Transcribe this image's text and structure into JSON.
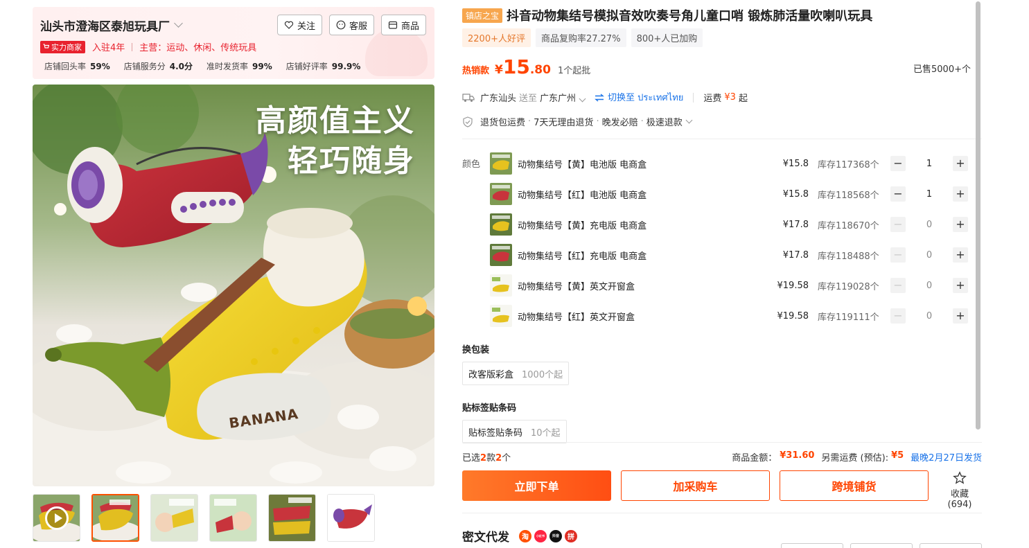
{
  "shop": {
    "name": "汕头市澄海区泰旭玩具厂",
    "follow_label": "关注",
    "service_label": "客服",
    "goods_label": "商品",
    "badge": "实力商家",
    "years": "入驻4年",
    "main_category": "主营：运动、休闲、传统玩具",
    "stats": [
      {
        "label": "店铺回头率",
        "value": "59%"
      },
      {
        "label": "店铺服务分",
        "value": "4.0分"
      },
      {
        "label": "准时发货率",
        "value": "99%"
      },
      {
        "label": "店铺好评率",
        "value": "99.9%"
      }
    ]
  },
  "gallery": {
    "slogan_line1": "高颜值主义",
    "slogan_line2": "轻巧随身",
    "product_print": "BANANA"
  },
  "product": {
    "shop_tag": "镇店之宝",
    "title": "抖音动物集结号模拟音效吹奏号角儿童口哨 锻炼肺活量吹喇叭玩具",
    "pills": [
      "2200+人好评",
      "商品复购率27.27%",
      "800+人已加购"
    ],
    "price_label": "热销款",
    "price_symbol": "¥",
    "price_int": "15",
    "price_dec": ".80",
    "moq": "1个起批",
    "sold": "已售5000+个"
  },
  "shipping": {
    "from": "广东汕头",
    "to_word": "送至",
    "to": "广东广州",
    "switch_label": "切换至 ประเทศไทย",
    "fee_label": "运费",
    "fee_value": "¥3",
    "fee_suffix": "起"
  },
  "services": {
    "items": [
      "退货包运费",
      "7天无理由退货",
      "晚发必赔",
      "极速退款"
    ]
  },
  "sku": {
    "label": "颜色",
    "rows": [
      {
        "name": "动物集结号【黄】电池版 电商盒",
        "price": "¥15.8",
        "stock": "库存117368个",
        "qty": "1"
      },
      {
        "name": "动物集结号【红】电池版 电商盒",
        "price": "¥15.8",
        "stock": "库存118568个",
        "qty": "1"
      },
      {
        "name": "动物集结号【黄】充电版 电商盒",
        "price": "¥17.8",
        "stock": "库存118670个",
        "qty": "0"
      },
      {
        "name": "动物集结号【红】充电版 电商盒",
        "price": "¥17.8",
        "stock": "库存118488个",
        "qty": "0"
      },
      {
        "name": "动物集结号【黄】英文开窗盒",
        "price": "¥19.58",
        "stock": "库存119028个",
        "qty": "0"
      },
      {
        "name": "动物集结号【红】英文开窗盒",
        "price": "¥19.58",
        "stock": "库存119111个",
        "qty": "0"
      }
    ]
  },
  "packaging": {
    "title": "换包装",
    "option": "改客版彩盒",
    "moq": "1000个起"
  },
  "labeling": {
    "title": "贴标签贴条码",
    "option": "贴标签贴条码",
    "moq": "10个起"
  },
  "summary": {
    "selected_prefix": "已选",
    "selected_kinds": "2",
    "selected_mid": "款",
    "selected_count": "2",
    "selected_suffix": "个",
    "amount_label": "商品金额：",
    "amount_value": "¥31.60",
    "extra_fee_label": "另需运费 (预估):",
    "extra_fee_value": "¥5",
    "delivery": "最晚2月27日发货"
  },
  "actions": {
    "buy_now": "立即下单",
    "add_cart": "加采购车",
    "cross_border": "跨境铺货",
    "favorite_label": "收藏",
    "favorite_count": "(694)"
  },
  "miwen": {
    "title": "密文代发",
    "platforms": [
      "淘",
      "小红书",
      "抖音",
      "拼"
    ]
  },
  "colors": {
    "accent": "#ff4400",
    "red_badge": "#e8222e",
    "link_blue": "#1a73e8",
    "shop_tag": "#f7a64e"
  }
}
